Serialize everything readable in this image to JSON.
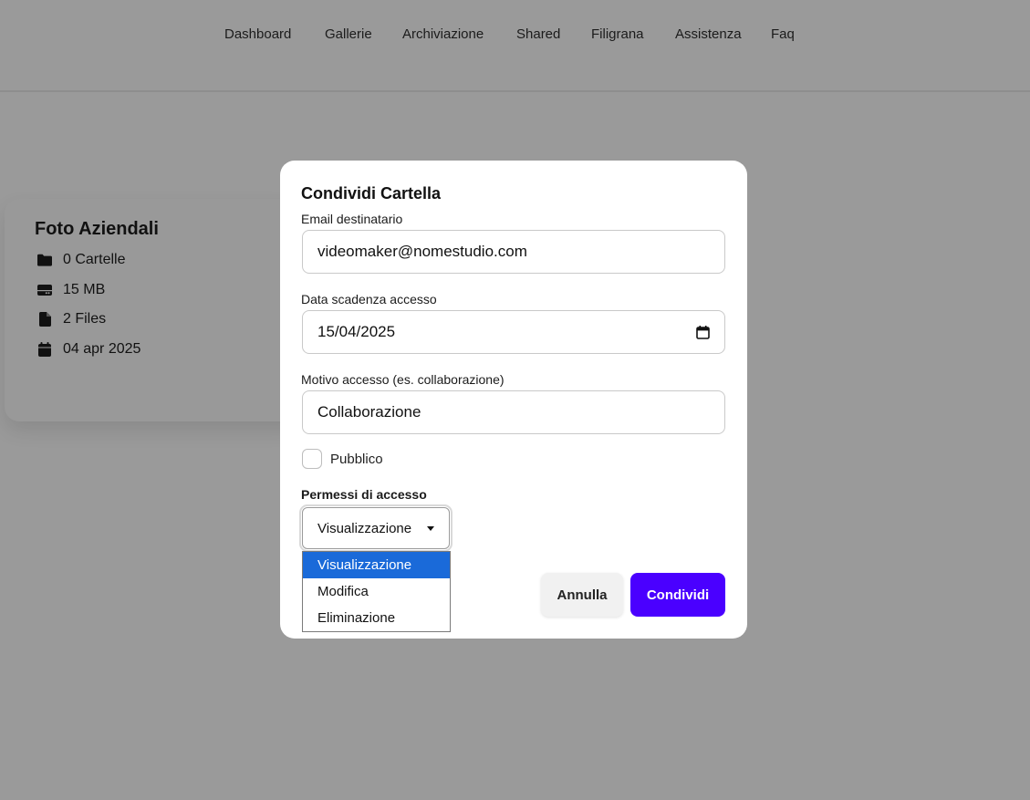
{
  "nav": {
    "items": [
      {
        "label": "Dashboard"
      },
      {
        "label": "Gallerie"
      },
      {
        "label": "Archiviazione"
      },
      {
        "label": "Shared"
      },
      {
        "label": "Filigrana"
      },
      {
        "label": "Assistenza"
      },
      {
        "label": "Faq"
      }
    ]
  },
  "folder_card": {
    "title": "Foto Aziendali",
    "meta": [
      {
        "icon": "folder-icon",
        "text": "0 Cartelle"
      },
      {
        "icon": "storage-icon",
        "text": "15 MB"
      },
      {
        "icon": "file-icon",
        "text": "2 Files"
      },
      {
        "icon": "calendar-icon",
        "text": "04 apr 2025"
      }
    ]
  },
  "modal": {
    "title": "Condividi Cartella",
    "email": {
      "label": "Email destinatario",
      "value": "videomaker@nomestudio.com"
    },
    "expiry": {
      "label": "Data scadenza accesso",
      "value": "15/04/2025",
      "icon": "calendar-icon"
    },
    "reason": {
      "label": "Motivo accesso (es. collaborazione)",
      "value": "Collaborazione"
    },
    "public": {
      "label": "Pubblico",
      "checked": false
    },
    "permissions": {
      "label": "Permessi di accesso",
      "selected": "Visualizzazione",
      "options": [
        "Visualizzazione",
        "Modifica",
        "Eliminazione"
      ]
    },
    "buttons": {
      "cancel": "Annulla",
      "share": "Condividi"
    }
  },
  "colors": {
    "overlay_background": "#9a9a9a",
    "primary_button": "#4a00ff",
    "dropdown_highlight": "#1a6ad9"
  }
}
